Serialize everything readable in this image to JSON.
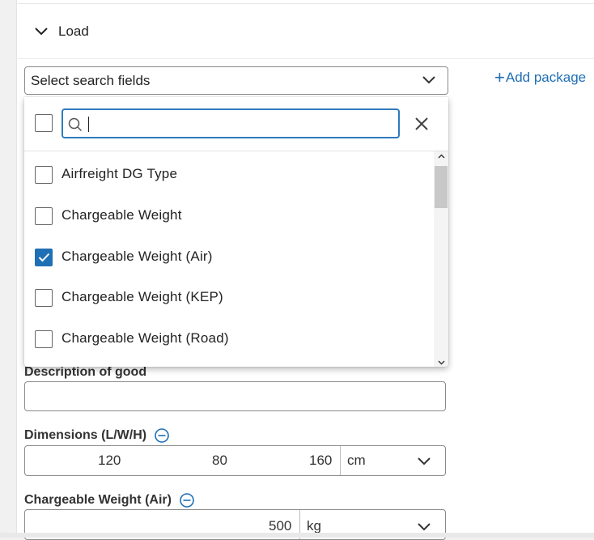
{
  "section": {
    "title": "Load"
  },
  "search_select": {
    "placeholder": "Select search fields"
  },
  "add_package": {
    "label": "Add package"
  },
  "dropdown": {
    "search_value": "",
    "options": [
      {
        "label": "Airfreight DG Type",
        "checked": false
      },
      {
        "label": "Chargeable Weight",
        "checked": false
      },
      {
        "label": "Chargeable Weight (Air)",
        "checked": true
      },
      {
        "label": "Chargeable Weight (KEP)",
        "checked": false
      },
      {
        "label": "Chargeable Weight (Road)",
        "checked": false
      }
    ]
  },
  "form": {
    "description": {
      "label": "Description of good",
      "value": ""
    },
    "dimensions": {
      "label": "Dimensions (L/W/H)",
      "length": "120",
      "width": "80",
      "height": "160",
      "unit": "cm"
    },
    "chargeable_weight_air": {
      "label": "Chargeable Weight (Air)",
      "value": "500",
      "unit": "kg"
    }
  },
  "colors": {
    "accent": "#1f6fb5",
    "focus": "#2f7bbd"
  }
}
